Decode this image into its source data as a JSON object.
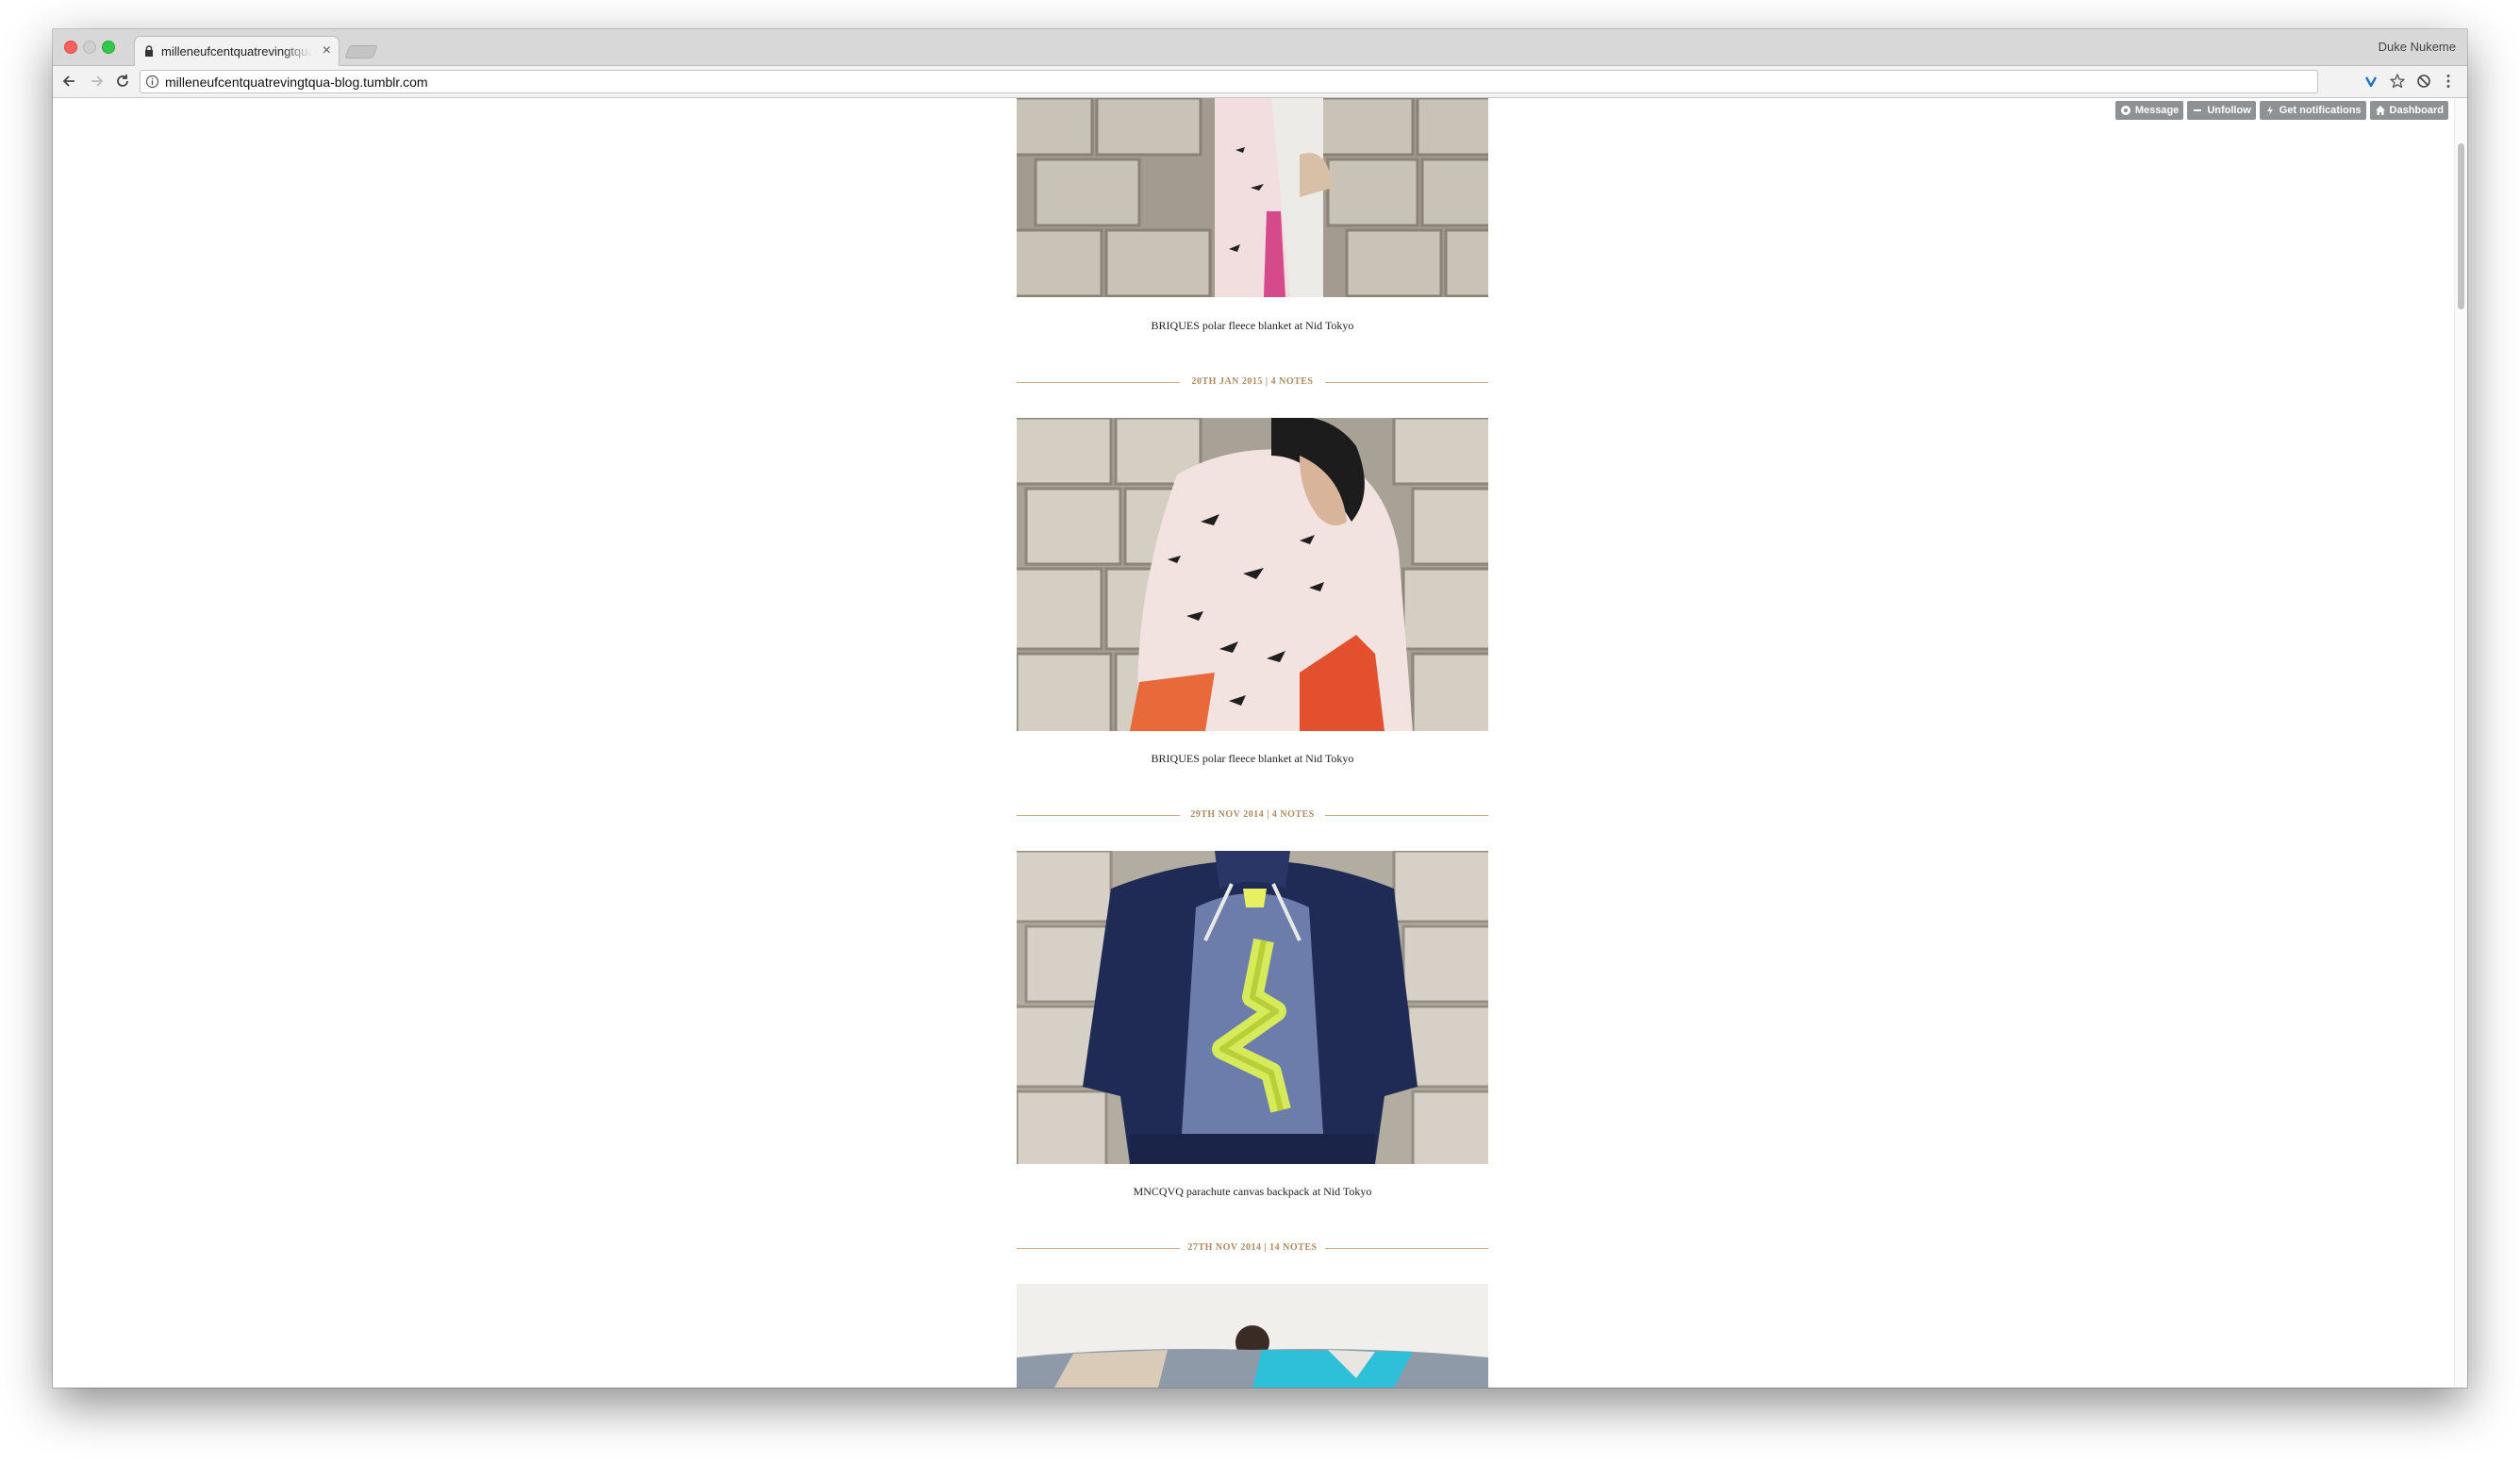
{
  "browser": {
    "tab_title": "milleneufcentquatrevingtqua-blog.tumblr.com",
    "tab_close": "×",
    "profile_name": "Duke Nukeme",
    "url": "milleneufcentquatrevingtqua-blog.tumblr.com"
  },
  "tumblr_controls": {
    "message": "Message",
    "unfollow": "Unfollow",
    "notifications": "Get notifications",
    "dashboard": "Dashboard"
  },
  "posts": [
    {
      "caption": "BRIQUES polar fleece blanket at Nid Tokyo",
      "meta": "20TH JAN 2015 | 4 NOTES"
    },
    {
      "caption": "BRIQUES polar fleece blanket at Nid Tokyo",
      "meta": "29TH NOV 2014 | 4 NOTES"
    },
    {
      "caption": "MNCQVQ parachute canvas backpack at Nid Tokyo",
      "meta": "27TH NOV 2014 | 14 NOTES"
    }
  ],
  "colors": {
    "accent_meta": "#b08a60",
    "rule": "#c9ad8a",
    "control_bg": "#8f9294"
  },
  "icons": [
    "lock-icon",
    "back-arrow-icon",
    "forward-arrow-icon",
    "reload-icon",
    "info-icon",
    "vivaldi-extension-icon",
    "star-icon",
    "extension-icon",
    "menu-dots-icon",
    "message-icon",
    "minus-icon",
    "bolt-icon",
    "home-icon"
  ]
}
